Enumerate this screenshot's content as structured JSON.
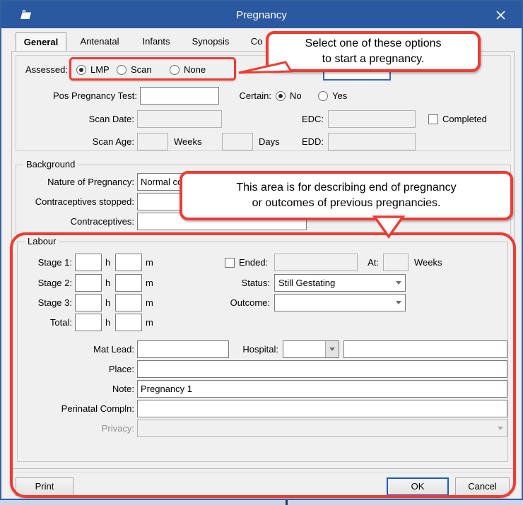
{
  "window": {
    "title": "Pregnancy"
  },
  "tabs": [
    {
      "label": "General",
      "active": true
    },
    {
      "label": "Antenatal",
      "active": false
    },
    {
      "label": "Infants",
      "active": false
    },
    {
      "label": "Synopsis",
      "active": false
    },
    {
      "label": "Co",
      "active": false
    }
  ],
  "general": {
    "assessed_label": "Assessed:",
    "assessed_options": [
      {
        "label": "LMP",
        "checked": true
      },
      {
        "label": "Scan",
        "checked": false
      },
      {
        "label": "None",
        "checked": false
      }
    ],
    "pos_test_label": "Pos Pregnancy Test:",
    "certain_label": "Certain:",
    "certain_options": [
      {
        "label": "No",
        "checked": true
      },
      {
        "label": "Yes",
        "checked": false
      }
    ],
    "scan_date_label": "Scan Date:",
    "scan_age_label": "Scan Age:",
    "weeks_label": "Weeks",
    "days_label": "Days",
    "edc_label": "EDC:",
    "edd_label": "EDD:",
    "completed_label": "Completed"
  },
  "background": {
    "title": "Background",
    "nature_label": "Nature of Pregnancy:",
    "nature_value": "Normal co",
    "stopped_label": "Contraceptives stopped:",
    "contraceptives_label": "Contraceptives:"
  },
  "labour": {
    "title": "Labour",
    "stage1_label": "Stage 1:",
    "stage2_label": "Stage 2:",
    "stage3_label": "Stage 3:",
    "total_label": "Total:",
    "h_label": "h",
    "m_label": "m",
    "ended_label": "Ended:",
    "at_label": "At:",
    "weeks_label": "Weeks",
    "status_label": "Status:",
    "status_value": "Still Gestating",
    "outcome_label": "Outcome:",
    "outcome_value": "",
    "mat_lead_label": "Mat Lead:",
    "hospital_label": "Hospital:",
    "place_label": "Place:",
    "note_label": "Note:",
    "note_value": "Pregnancy 1",
    "perinatal_label": "Perinatal Compln:",
    "privacy_label": "Privacy:"
  },
  "footer": {
    "print": "Print",
    "ok": "OK",
    "cancel": "Cancel"
  },
  "annotations": {
    "callout1_line1": "Select one of these options",
    "callout1_line2": "to start a pregnancy.",
    "callout2_line1": "This area is for describing end of pregnancy",
    "callout2_line2": "or outcomes of previous pregnancies.",
    "highlight_color": "#ee3b33"
  },
  "colors": {
    "titlebar": "#2b59a1",
    "annotation_red": "#ee3b33",
    "dialog_bg": "#f0f0f0"
  }
}
